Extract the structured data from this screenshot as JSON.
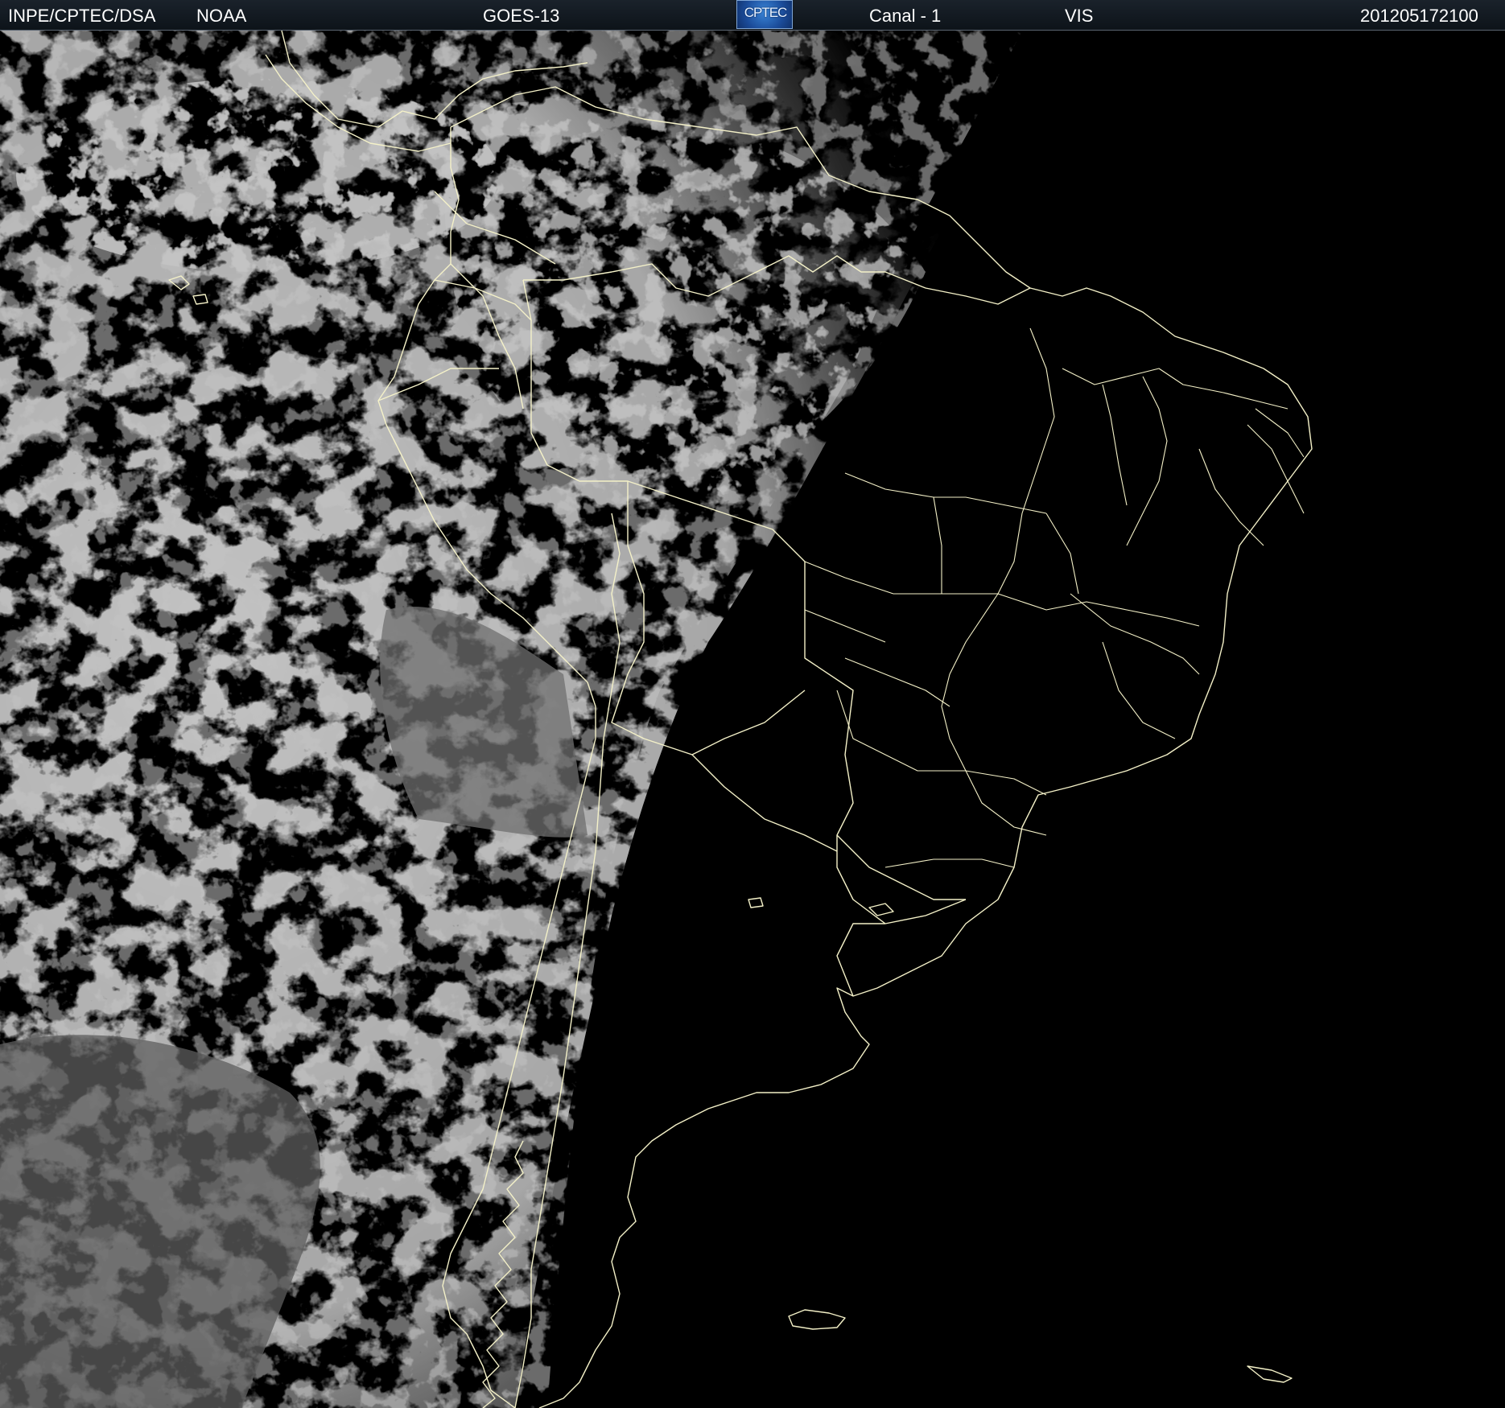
{
  "header": {
    "agency": "INPE/CPTEC/DSA",
    "provider": "NOAA",
    "satellite": "GOES-13",
    "logo_text": "CPTEC",
    "channel": "Canal - 1",
    "band": "VIS",
    "timestamp": "201205172100"
  },
  "image": {
    "description_colors": {
      "background": "#000000",
      "cloud": "#9a9a9a",
      "map_lines": "#f4f1c8"
    }
  }
}
